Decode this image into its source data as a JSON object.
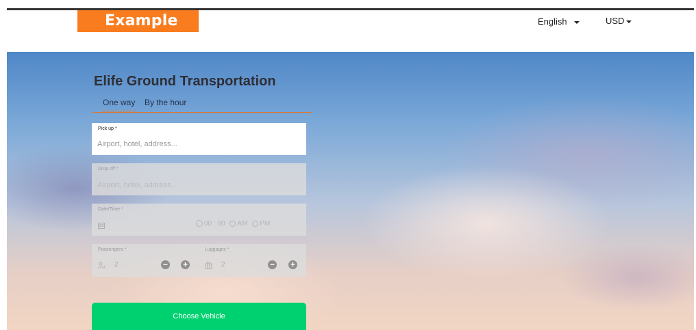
{
  "header": {
    "logo_text": "Example",
    "language": "English",
    "currency": "USD"
  },
  "form": {
    "title": "Elife Ground Transportation",
    "tabs": [
      {
        "label": "One way",
        "active": true
      },
      {
        "label": "By the hour",
        "active": false
      }
    ],
    "pickup": {
      "label": "Pick up *",
      "placeholder": "Airport, hotel, address..."
    },
    "dropoff": {
      "label": "Drop off *",
      "placeholder": "Airport, hotel, address..."
    },
    "datetime": {
      "label": "Date/Time *",
      "time": "00 : 00",
      "am": "AM",
      "pm": "PM"
    },
    "passengers": {
      "label": "Passengers *",
      "value": "2"
    },
    "luggages": {
      "label": "Luggages *",
      "value": "2"
    },
    "submit_label": "Choose Vehicle"
  },
  "colors": {
    "brand_orange": "#f97d1f",
    "accent_green": "#00d170",
    "tab_underline": "#e0762a"
  }
}
